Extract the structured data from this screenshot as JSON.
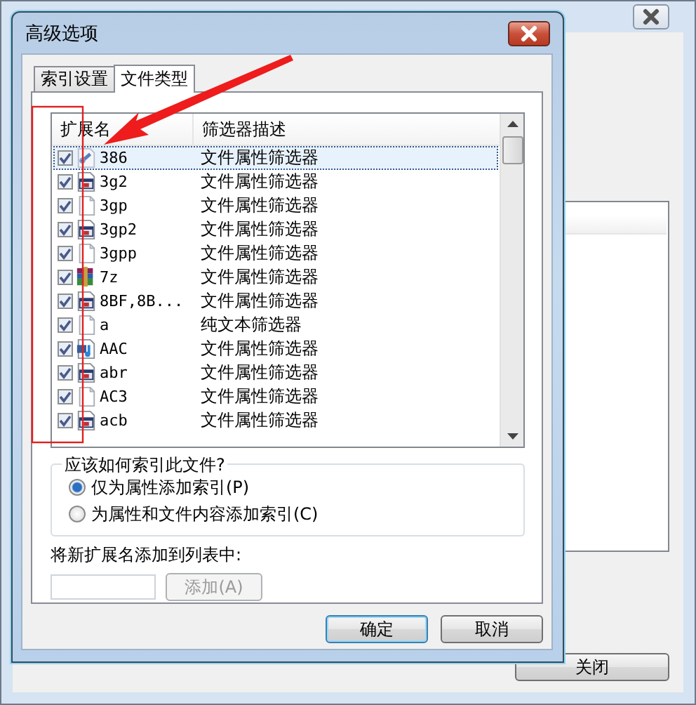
{
  "background_window": {
    "close_button": "关闭"
  },
  "dialog": {
    "title": "高级选项",
    "tabs": [
      {
        "label": "索引设置",
        "selected": false
      },
      {
        "label": "文件类型",
        "selected": true
      }
    ],
    "file_types": {
      "columns": [
        "扩展名",
        "筛选器描述"
      ],
      "rows": [
        {
          "extension": "386",
          "filter": "文件属性筛选器",
          "checked": true,
          "selected": true,
          "kind": "link"
        },
        {
          "extension": "3g2",
          "filter": "文件属性筛选器",
          "checked": true,
          "selected": false,
          "kind": "app"
        },
        {
          "extension": "3gp",
          "filter": "文件属性筛选器",
          "checked": true,
          "selected": false,
          "kind": "blank"
        },
        {
          "extension": "3gp2",
          "filter": "文件属性筛选器",
          "checked": true,
          "selected": false,
          "kind": "app"
        },
        {
          "extension": "3gpp",
          "filter": "文件属性筛选器",
          "checked": true,
          "selected": false,
          "kind": "blank"
        },
        {
          "extension": "7z",
          "filter": "文件属性筛选器",
          "checked": true,
          "selected": false,
          "kind": "archive"
        },
        {
          "extension": "8BF,8B...",
          "filter": "文件属性筛选器",
          "checked": true,
          "selected": false,
          "kind": "app"
        },
        {
          "extension": "a",
          "filter": "纯文本筛选器",
          "checked": true,
          "selected": false,
          "kind": "blank"
        },
        {
          "extension": "AAC",
          "filter": "文件属性筛选器",
          "checked": true,
          "selected": false,
          "kind": "audio"
        },
        {
          "extension": "abr",
          "filter": "文件属性筛选器",
          "checked": true,
          "selected": false,
          "kind": "app"
        },
        {
          "extension": "AC3",
          "filter": "文件属性筛选器",
          "checked": true,
          "selected": false,
          "kind": "blank"
        },
        {
          "extension": "acb",
          "filter": "文件属性筛选器",
          "checked": true,
          "selected": false,
          "kind": "app"
        }
      ]
    },
    "index_mode": {
      "legend": "应该如何索引此文件?",
      "options": [
        {
          "label": "仅为属性添加索引(P)",
          "selected": true
        },
        {
          "label": "为属性和文件内容添加索引(C)",
          "selected": false
        }
      ]
    },
    "add_extension": {
      "label": "将新扩展名添加到列表中:",
      "button": {
        "label": "添加(A)",
        "disabled": true
      }
    },
    "buttons": [
      "确定",
      "取消"
    ]
  }
}
